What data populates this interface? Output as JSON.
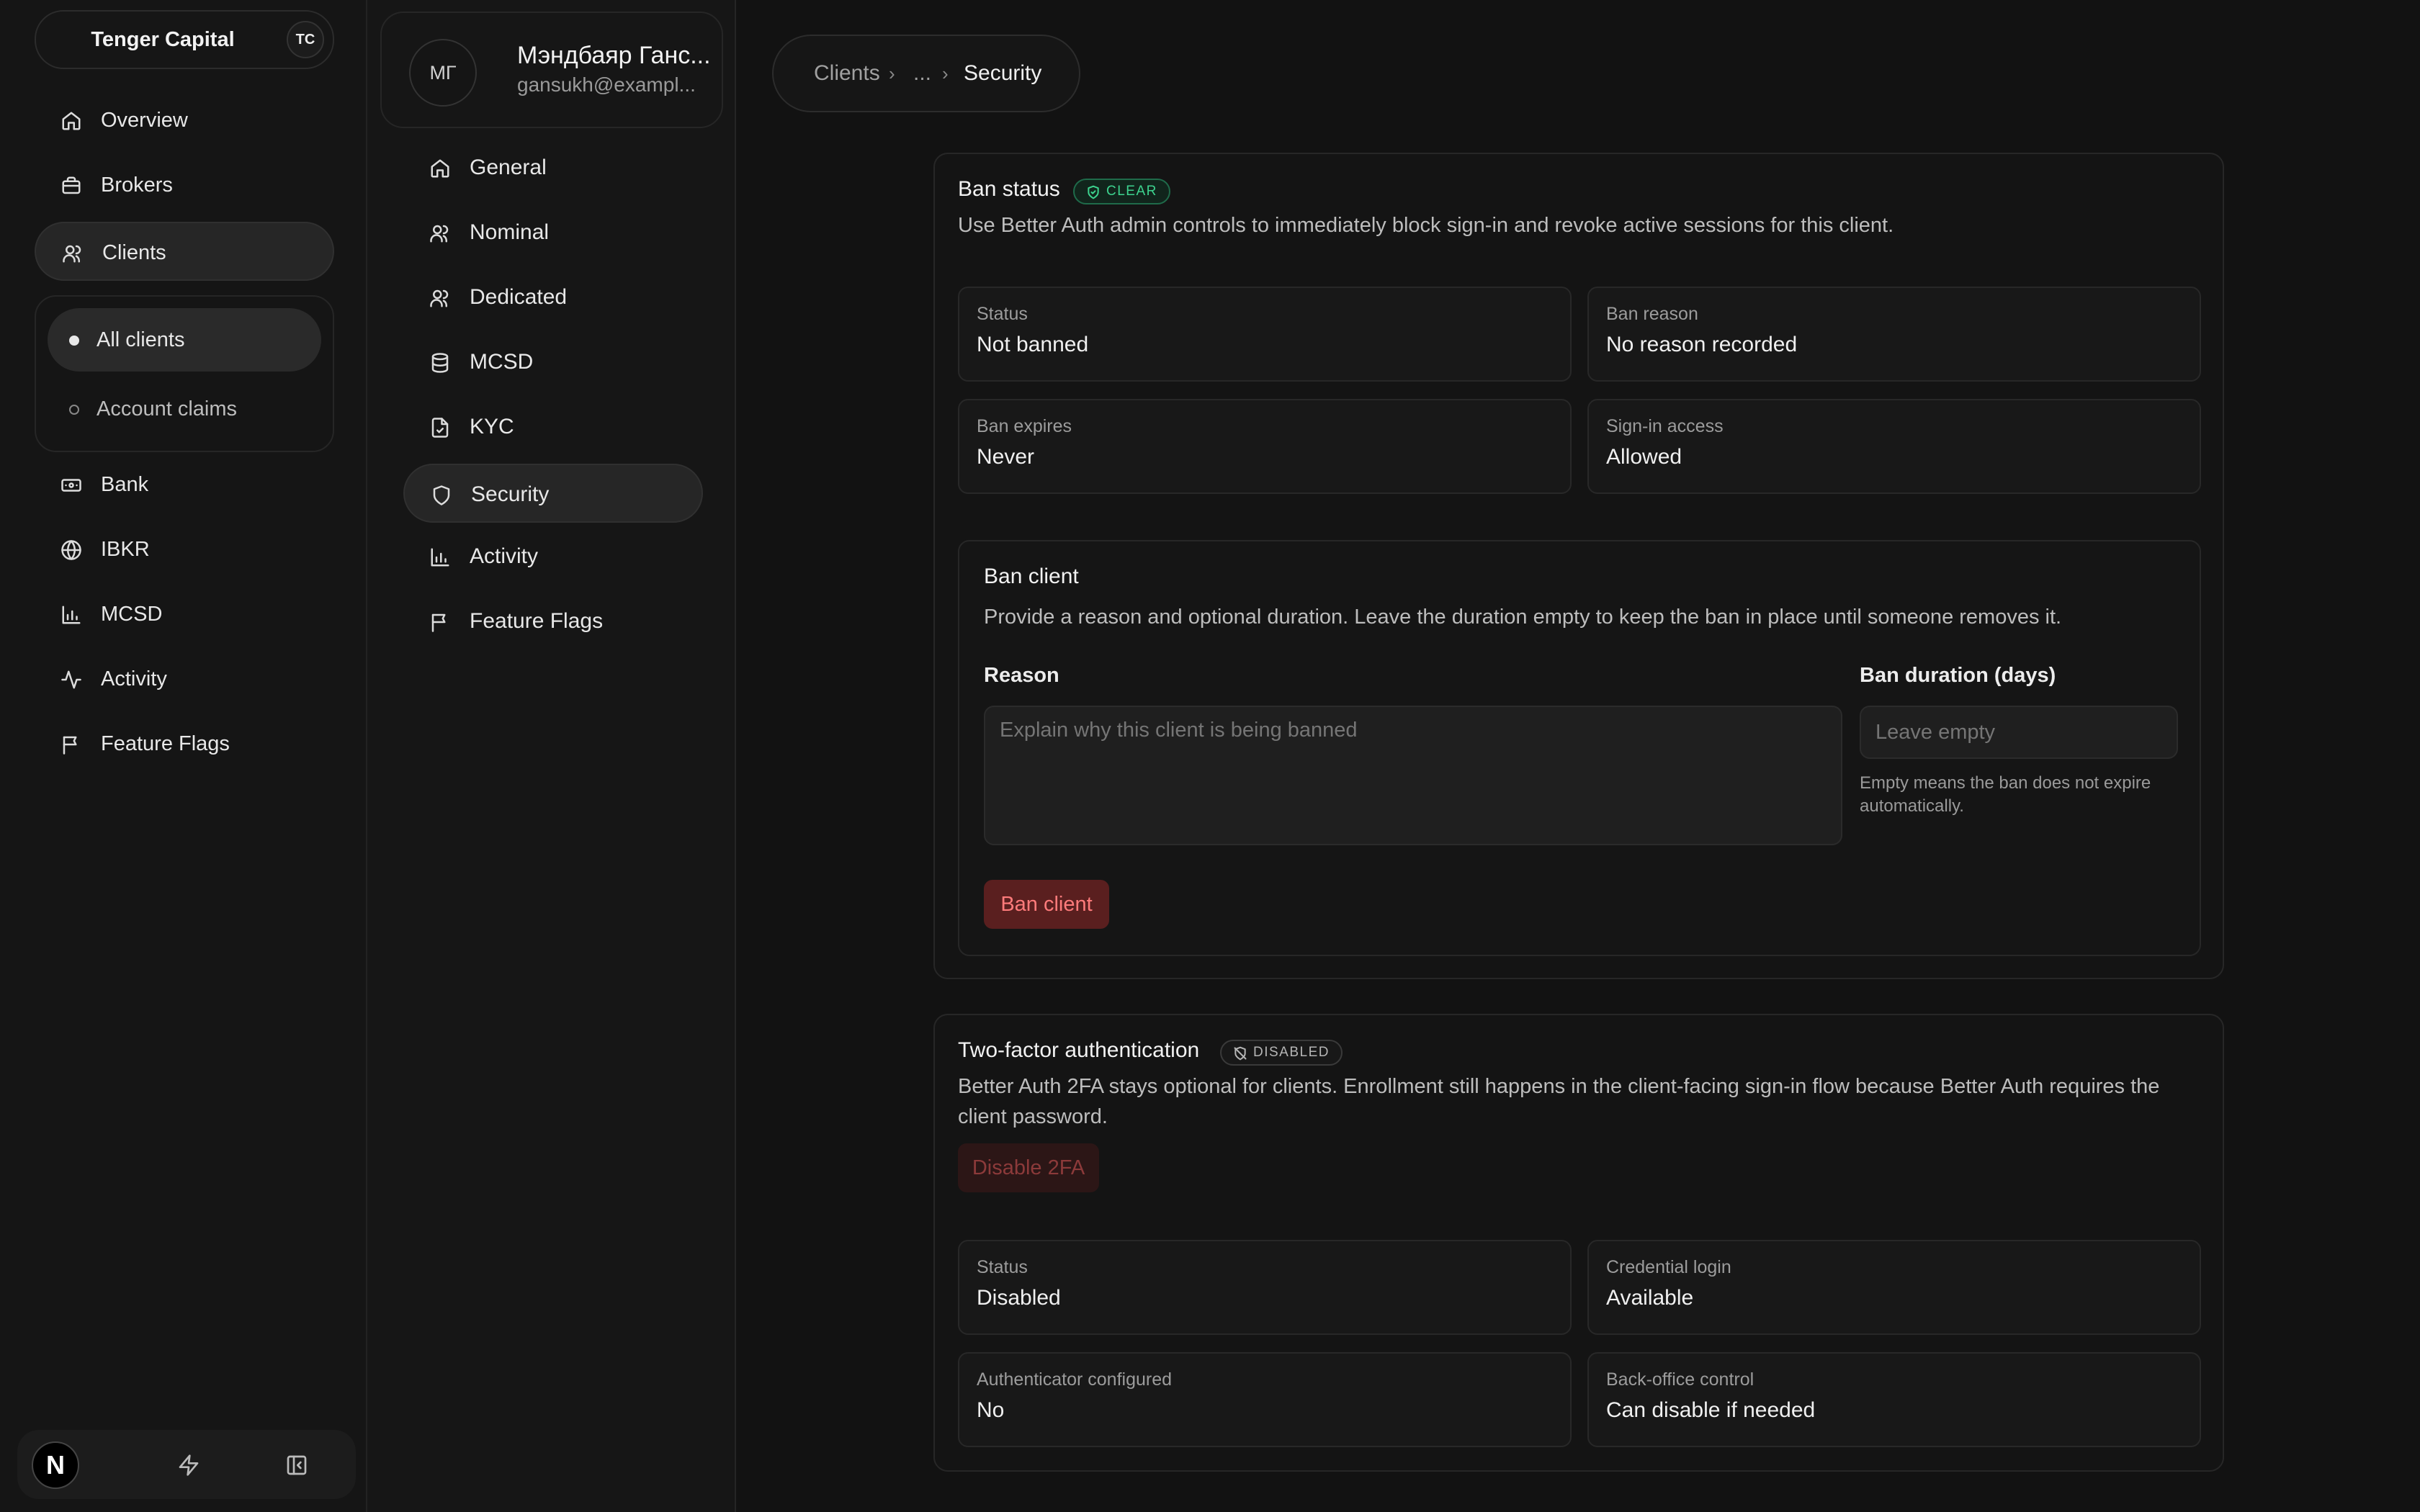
{
  "sidebar": {
    "org_name": "Tenger Capital",
    "org_badge": "TC",
    "items": [
      {
        "label": "Overview",
        "icon": "home-icon"
      },
      {
        "label": "Brokers",
        "icon": "briefcase-icon"
      },
      {
        "label": "Clients",
        "icon": "users-icon"
      },
      {
        "label": "Bank",
        "icon": "banknote-icon"
      },
      {
        "label": "IBKR",
        "icon": "globe-icon"
      },
      {
        "label": "MCSD",
        "icon": "bar-chart-icon"
      },
      {
        "label": "Activity",
        "icon": "activity-icon"
      },
      {
        "label": "Feature Flags",
        "icon": "flag-icon"
      }
    ],
    "clients_sub": [
      {
        "label": "All clients"
      },
      {
        "label": "Account claims"
      }
    ],
    "footer_logo": "N"
  },
  "client": {
    "initials": "МГ",
    "name": "Мэндбаяр Ганс...",
    "email": "gansukh@exampl...",
    "nav": [
      {
        "label": "General",
        "icon": "home-icon"
      },
      {
        "label": "Nominal",
        "icon": "users-icon"
      },
      {
        "label": "Dedicated",
        "icon": "users-icon"
      },
      {
        "label": "MCSD",
        "icon": "database-icon"
      },
      {
        "label": "KYC",
        "icon": "file-check-icon"
      },
      {
        "label": "Security",
        "icon": "shield-icon"
      },
      {
        "label": "Activity",
        "icon": "bar-chart-icon"
      },
      {
        "label": "Feature Flags",
        "icon": "flag-icon"
      }
    ]
  },
  "breadcrumb": {
    "root": "Clients",
    "middle": "...",
    "current": "Security"
  },
  "ban_status": {
    "title": "Ban status",
    "badge": "CLEAR",
    "description": "Use Better Auth admin controls to immediately block sign-in and revoke active sessions for this client.",
    "tiles": [
      {
        "label": "Status",
        "value": "Not banned"
      },
      {
        "label": "Ban reason",
        "value": "No reason recorded"
      },
      {
        "label": "Ban expires",
        "value": "Never"
      },
      {
        "label": "Sign-in access",
        "value": "Allowed"
      }
    ],
    "form": {
      "title": "Ban client",
      "description": "Provide a reason and optional duration. Leave the duration empty to keep the ban in place until someone removes it.",
      "reason_label": "Reason",
      "reason_placeholder": "Explain why this client is being banned",
      "duration_label": "Ban duration (days)",
      "duration_placeholder": "Leave empty",
      "duration_help": "Empty means the ban does not expire automatically.",
      "submit_label": "Ban client"
    }
  },
  "two_factor": {
    "title": "Two-factor authentication",
    "badge": "DISABLED",
    "description": "Better Auth 2FA stays optional for clients. Enrollment still happens in the client-facing sign-in flow because Better Auth requires the client password.",
    "disable_label": "Disable 2FA",
    "tiles": [
      {
        "label": "Status",
        "value": "Disabled"
      },
      {
        "label": "Credential login",
        "value": "Available"
      },
      {
        "label": "Authenticator configured",
        "value": "No"
      },
      {
        "label": "Back-office control",
        "value": "Can disable if needed"
      }
    ]
  },
  "colors": {
    "background": "#121212",
    "success": "#3dd48f",
    "danger": "#ff7b7b"
  }
}
